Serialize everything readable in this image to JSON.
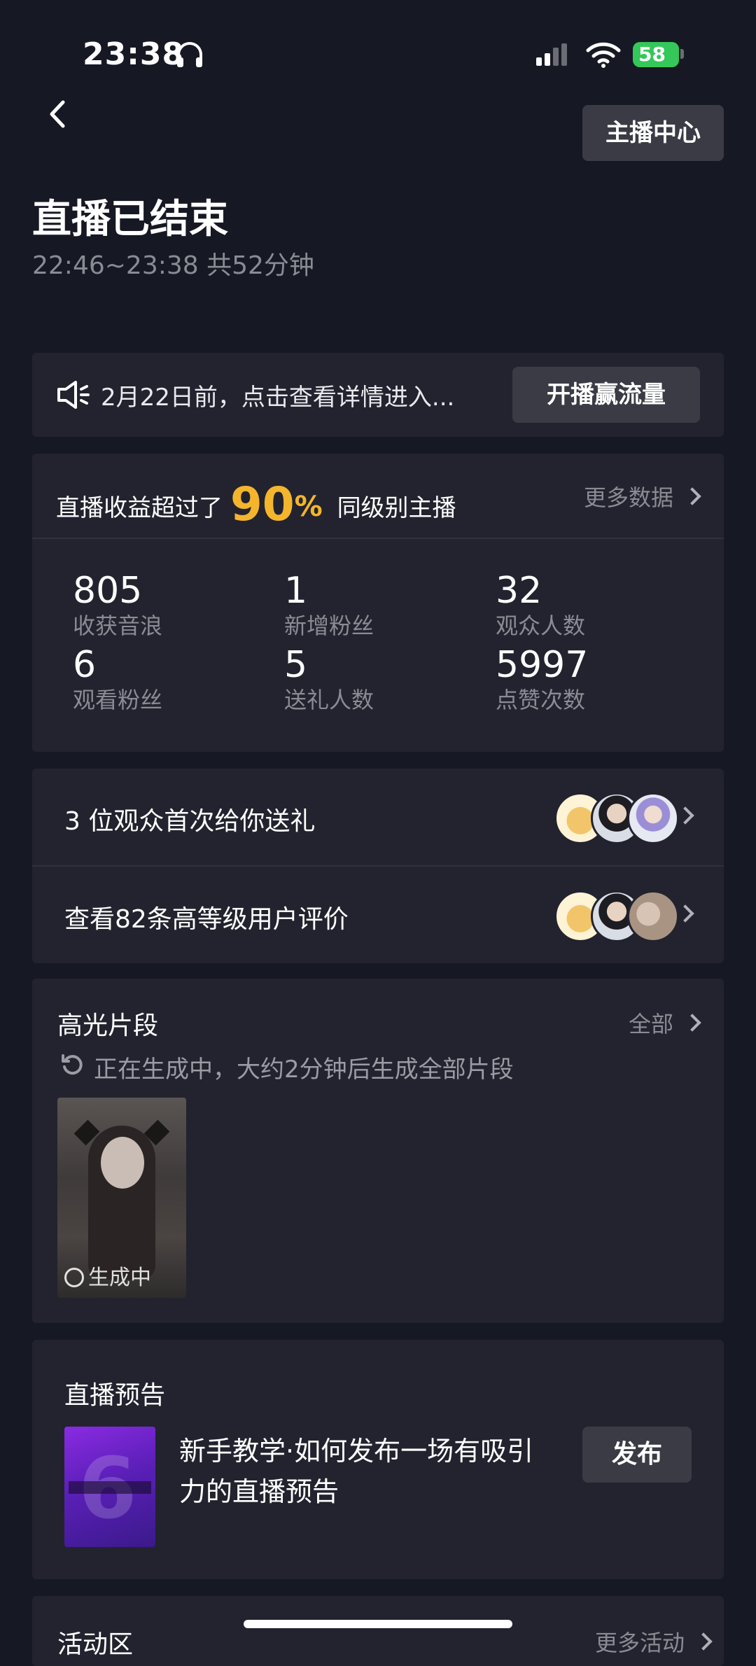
{
  "status_bar": {
    "time": "23:38",
    "battery": "58"
  },
  "header": {
    "anchor_center": "主播中心",
    "title": "直播已结束",
    "subtitle": "22:46~23:38 共52分钟"
  },
  "notice": {
    "text": "2月22日前，点击查看详情进入...",
    "button": "开播赢流量"
  },
  "stats": {
    "head_prefix": "直播收益超过了",
    "percent": "90",
    "percent_sign": "%",
    "head_suffix": "同级别主播",
    "more": "更多数据",
    "items": [
      {
        "value": "805",
        "label": "收获音浪"
      },
      {
        "value": "1",
        "label": "新增粉丝"
      },
      {
        "value": "32",
        "label": "观众人数"
      },
      {
        "value": "6",
        "label": "观看粉丝"
      },
      {
        "value": "5",
        "label": "送礼人数"
      },
      {
        "value": "5997",
        "label": "点赞次数"
      }
    ]
  },
  "rows": [
    {
      "text": "3 位观众首次给你送礼"
    },
    {
      "text": "查看82条高等级用户评价"
    }
  ],
  "highlights": {
    "title": "高光片段",
    "all": "全部",
    "status": "正在生成中，大约2分钟后生成全部片段",
    "clip_status": "生成中"
  },
  "preview": {
    "title": "直播预告",
    "text": "新手教学·如何发布一场有吸引力的直播预告",
    "button": "发布"
  },
  "activity": {
    "title": "活动区",
    "more": "更多活动"
  }
}
